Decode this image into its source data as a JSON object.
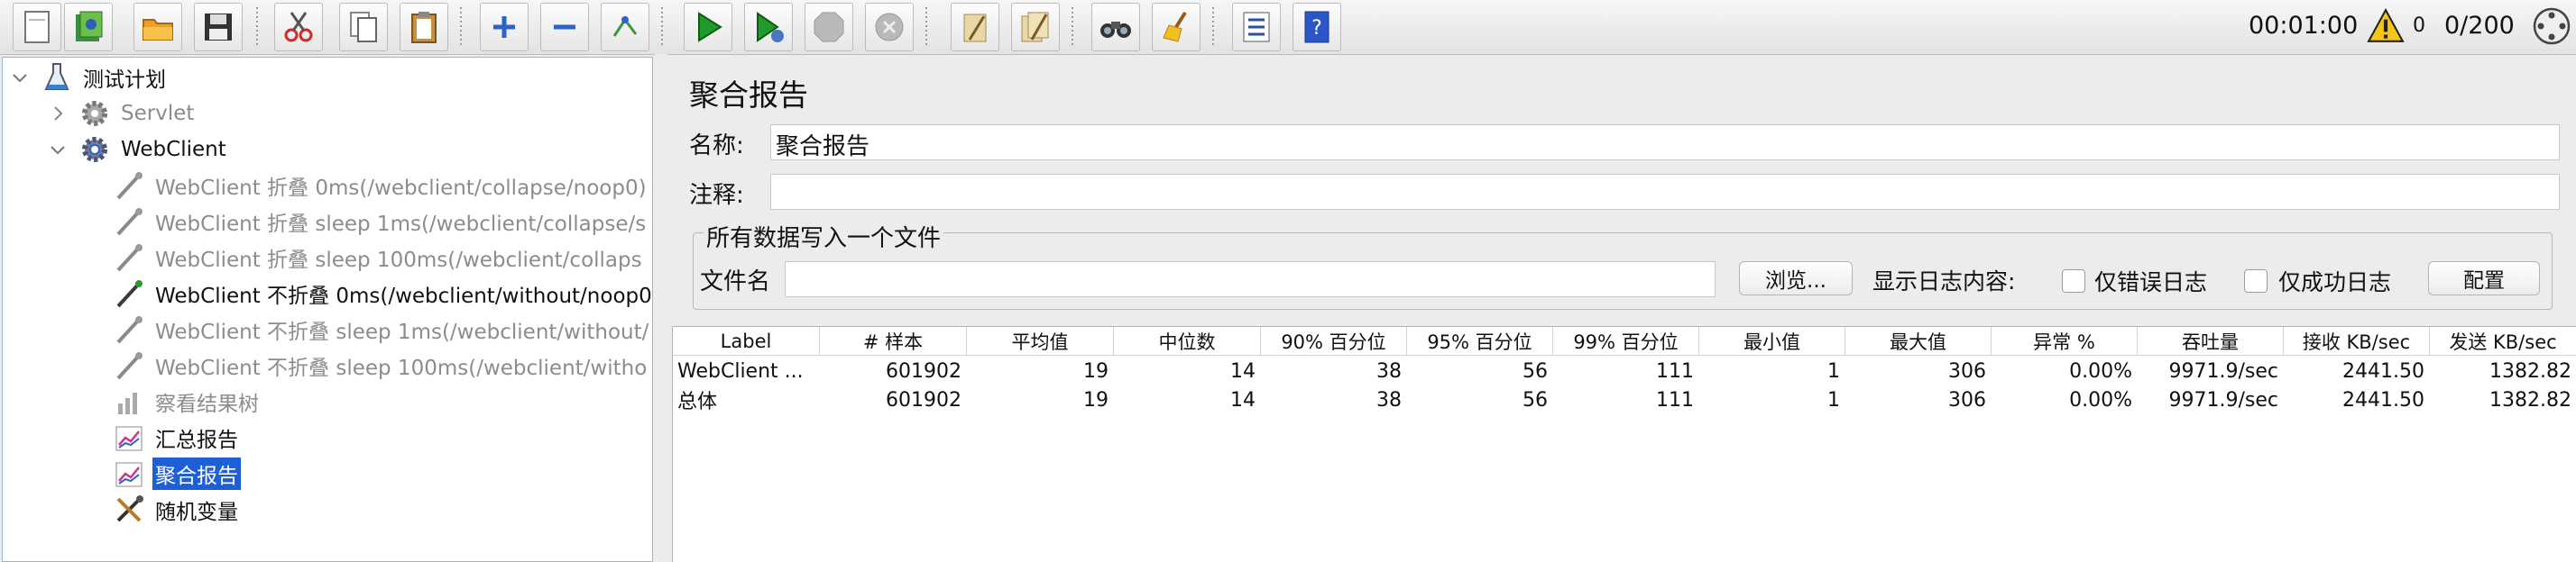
{
  "toolbar": {
    "timer": "00:01:00",
    "warning_count": "0",
    "threads": "0/200"
  },
  "tree": {
    "root": "测试计划",
    "servlet": "Servlet",
    "webclient": "WebClient",
    "samplers": [
      {
        "label": "WebClient 折叠 0ms(/webclient/collapse/noop0)",
        "enabled": false
      },
      {
        "label": "WebClient 折叠 sleep 1ms(/webclient/collapse/s",
        "enabled": false
      },
      {
        "label": "WebClient 折叠 sleep 100ms(/webclient/collaps",
        "enabled": false
      },
      {
        "label": "WebClient 不折叠 0ms(/webclient/without/noop0",
        "enabled": true
      },
      {
        "label": "WebClient 不折叠 sleep 1ms(/webclient/without/",
        "enabled": false
      },
      {
        "label": "WebClient 不折叠 sleep 100ms(/webclient/witho",
        "enabled": false
      }
    ],
    "result_tree": "察看结果树",
    "summary_report": "汇总报告",
    "aggregate_report": "聚合报告",
    "random_variable": "随机变量"
  },
  "panel": {
    "title": "聚合报告",
    "name_label": "名称:",
    "name_value": "聚合报告",
    "comment_label": "注释:",
    "comment_value": "",
    "file_group": "所有数据写入一个文件",
    "filename_label": "文件名",
    "filename_value": "",
    "browse": "浏览...",
    "log_label": "显示日志内容:",
    "errors_only": "仅错误日志",
    "success_only": "仅成功日志",
    "configure": "配置"
  },
  "table": {
    "columns": [
      "Label",
      "# 样本",
      "平均值",
      "中位数",
      "90% 百分位",
      "95% 百分位",
      "99% 百分位",
      "最小值",
      "最大值",
      "异常 %",
      "吞吐量",
      "接收 KB/sec",
      "发送 KB/sec"
    ],
    "rows": [
      [
        "WebClient ...",
        "601902",
        "19",
        "14",
        "38",
        "56",
        "111",
        "1",
        "306",
        "0.00%",
        "9971.9/sec",
        "2441.50",
        "1382.82"
      ],
      [
        "总体",
        "601902",
        "19",
        "14",
        "38",
        "56",
        "111",
        "1",
        "306",
        "0.00%",
        "9971.9/sec",
        "2441.50",
        "1382.82"
      ]
    ]
  }
}
